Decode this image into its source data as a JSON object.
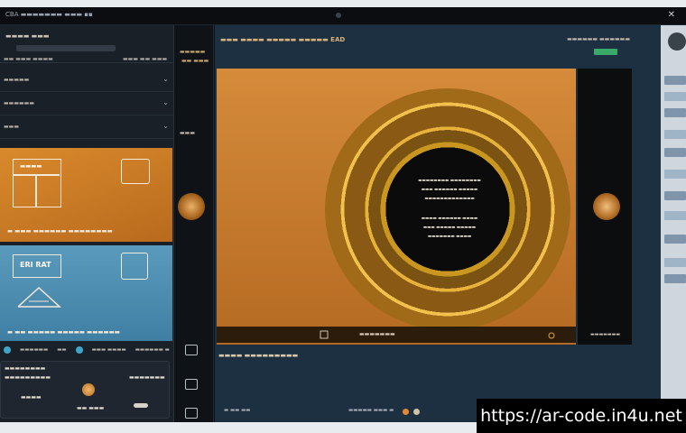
{
  "titlebar": {
    "app_title": "CBA ▬▬▬▬▬▬▬ ▬▬▬ ▪▪",
    "close_glyph": "✕"
  },
  "sidebar": {
    "title": "▬▬▬▬ ▬▬▬",
    "sub_left": "▬▬ ▬▬▬ ▬▬▬▬",
    "sub_right": "▬▬▬ ▬▬ ▬▬▬",
    "items": [
      {
        "label": "▬▬▬▬▬"
      },
      {
        "label": "▬▬▬▬▬▬"
      },
      {
        "label": "▬▬▬"
      }
    ],
    "card_orange": {
      "label": "▬▬▬▬",
      "footer": "▬ ▬▬▬ ▬▬▬▬▬▬ ▬▬▬▬▬▬▬▬"
    },
    "card_blue": {
      "label": "ERI RAT",
      "footer": "▬ ▬▬ ▬▬▬▬▬ ▬▬▬▬▬ ▬▬▬▬▬▬"
    },
    "toolbar": [
      "▬▬▬▬▬▬",
      "▬▬",
      "▬▬▬ ▬▬▬▬",
      "▬▬▬▬▬▬ ▬"
    ],
    "panel": {
      "title": "▬▬▬▬▬▬▬▬",
      "subtitle": "▬▬▬▬▬▬▬▬▬",
      "value_left": "▬▬▬▬",
      "value_mid": "▬▬ ▬▬▬",
      "right_title": "▬▬▬▬▬▬▬"
    }
  },
  "strip": {
    "label_top": "▬▬▬▬▬",
    "label_sub": "▬▬ ▬▬▬",
    "label_mid": "▬▬▬"
  },
  "main": {
    "heading": "▬▬▬ ▬▬▬▬ ▬▬▬▬▬ ▬▬▬▬▬ EAD",
    "right_head": "▬▬▬▬▬▬ ▬▬▬▬▬▬",
    "ring_lines": [
      "▬▬▬▬▬▬▬▬ ▬▬▬▬▬▬▬▬",
      "▬▬▬ ▬▬▬▬▬▬ ▬▬▬▬▬",
      "▬▬▬▬▬▬▬▬▬▬▬▬▬",
      "▬▬▬▬ ▬▬▬▬▬▬ ▬▬▬▬",
      "▬▬▬ ▬▬▬▬▬ ▬▬▬▬▬",
      "▬▬▬▬▬▬▬ ▬▬▬▬"
    ],
    "viewer_footer": {
      "center": "▬▬▬▬▬▬▬",
      "right": "▬▬▬▬▬▬▬"
    },
    "caption": "▬▬▬▬ ▬▬▬▬▬▬▬▬▬",
    "bottom_left": "▬ ▬▬ ▬▬",
    "bottom_right": "▬▬▬▬▬ ▬▬▬ ▬"
  },
  "colors": {
    "accent_orange": "#d98a2c",
    "accent_blue": "#5a9bbd",
    "gold": "#e7b23a",
    "green": "#39a86b"
  },
  "watermark": "https://ar-code.in4u.net"
}
